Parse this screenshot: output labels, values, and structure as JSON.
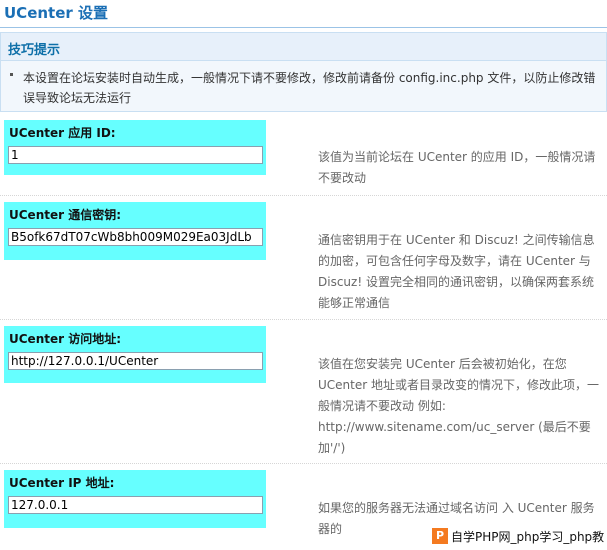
{
  "page": {
    "title": "UCenter 设置"
  },
  "tips": {
    "title": "技巧提示",
    "text": "本设置在论坛安装时自动生成，一般情况下请不要修改，修改前请备份 config.inc.php 文件，以防止修改错误导致论坛无法运行"
  },
  "settings": [
    {
      "label": "UCenter 应用 ID:",
      "value": "1",
      "description": "该值为当前论坛在 UCenter 的应用 ID，一般情况请不要改动"
    },
    {
      "label": "UCenter 通信密钥:",
      "value": "B5ofk67dT07cWb8bh009M029Ea03JdLb",
      "description": "通信密钥用于在 UCenter 和 Discuz! 之间传输信息的加密，可包含任何字母及数字，请在 UCenter 与 Discuz! 设置完全相同的通讯密钥，以确保两套系统能够正常通信"
    },
    {
      "label": "UCenter 访问地址:",
      "value": "http://127.0.0.1/UCenter",
      "description": "该值在您安装完 UCenter 后会被初始化，在您 UCenter 地址或者目录改变的情况下，修改此项，一般情况请不要改动 例如: http://www.sitename.com/uc_server (最后不要加'/')"
    },
    {
      "label": "UCenter IP 地址:",
      "value": "127.0.0.1",
      "description": "如果您的服务器无法通过域名访问 入 UCenter 服务器的"
    }
  ],
  "watermark": {
    "logo": "P",
    "text": "自学PHP网_php学习_php教"
  }
}
